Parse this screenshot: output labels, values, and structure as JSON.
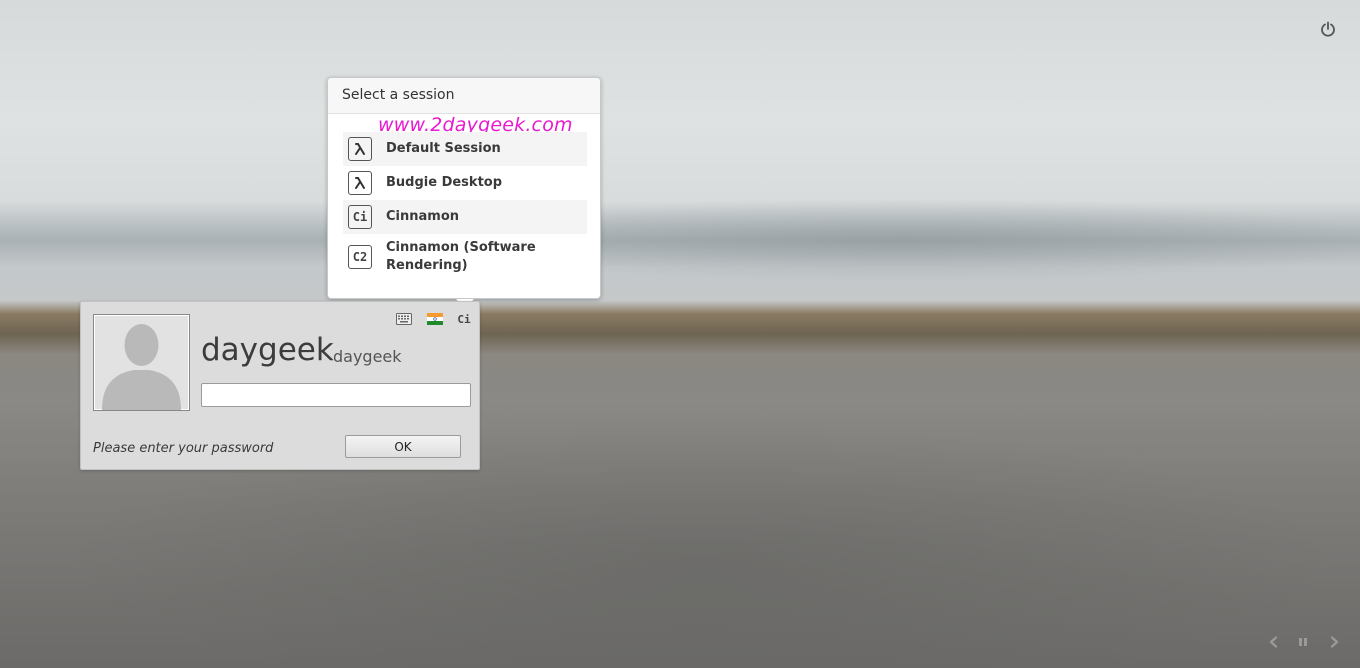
{
  "session_popup": {
    "title": "Select a session",
    "watermark": "www.2daygeek.com",
    "sessions": [
      {
        "icon": "lambda-icon",
        "label": "Default Session"
      },
      {
        "icon": "lambda-icon",
        "label": "Budgie Desktop"
      },
      {
        "icon": "cinnamon-icon",
        "icon_text": "Ci",
        "label": "Cinnamon"
      },
      {
        "icon": "cinnamon-software-icon",
        "icon_text": "C2",
        "label": "Cinnamon (Software Rendering)"
      }
    ]
  },
  "login": {
    "display_name": "daygeek",
    "username": "daygeek",
    "password_value": "",
    "prompt": "Please enter your password",
    "ok_label": "OK",
    "indicators": [
      {
        "icon": "keyboard-icon"
      },
      {
        "icon": "india-flag-icon"
      },
      {
        "icon": "session-indicator-icon",
        "text": "Ci"
      }
    ]
  },
  "top_right": {
    "icon": "power-icon"
  },
  "slideshow_controls": [
    {
      "icon": "previous-icon"
    },
    {
      "icon": "pause-icon"
    },
    {
      "icon": "next-icon"
    }
  ],
  "colors": {
    "watermark": "#e81ad1",
    "popup_bg": "#ffffff",
    "login_bg": "#dcdcdc"
  }
}
